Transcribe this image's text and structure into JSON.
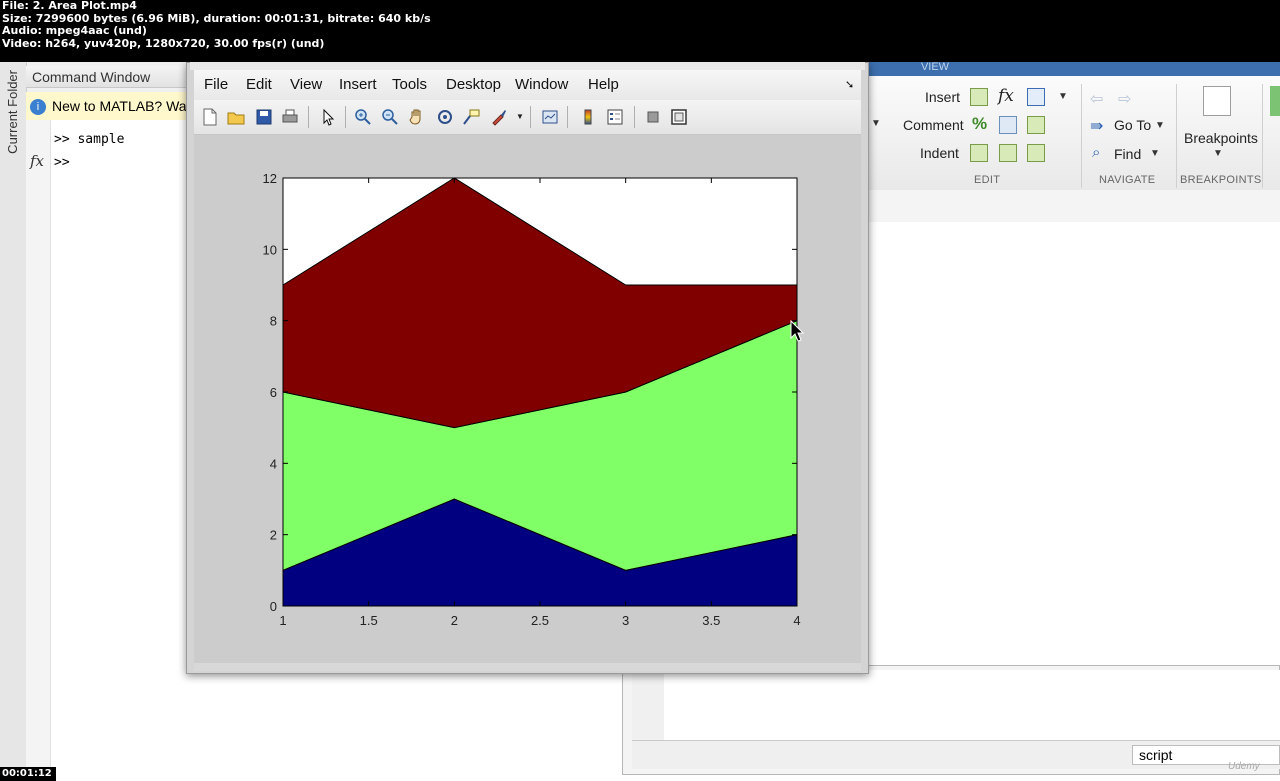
{
  "video_info": {
    "line1": "File: 2. Area Plot.mp4",
    "line2": "Size: 7299600 bytes (6.96 MiB), duration: 00:01:31, bitrate: 640 kb/s",
    "line3": "Audio: mpeg4aac (und)",
    "line4": "Video: h264, yuv420p, 1280x720, 30.00 fps(r) (und)"
  },
  "timecode": "00:01:12",
  "matlab": {
    "left_strip_label": "Current Folder",
    "command_window": {
      "title": "Command Window",
      "banner": "New to MATLAB? Wa",
      "lines": [
        ">> sample",
        ">>"
      ],
      "fx_symbol": "fx"
    },
    "ribbon": {
      "tab_label": "VIEW",
      "edit_rows": [
        {
          "label": "Insert",
          "extra": "fx"
        },
        {
          "label": "Comment",
          "extra": "%"
        },
        {
          "label": "Indent",
          "extra": ""
        }
      ],
      "navigate": {
        "goto_label": "Go To",
        "find_label": "Find"
      },
      "breakpoints_label": "Breakpoints",
      "sections": [
        "EDIT",
        "NAVIGATE",
        "BREAKPOINTS"
      ]
    },
    "editor": {
      "status_value": "script"
    }
  },
  "figure": {
    "menu": [
      "File",
      "Edit",
      "View",
      "Insert",
      "Tools",
      "Desktop",
      "Window",
      "Help"
    ],
    "toolbar_icons": [
      "new-figure-icon",
      "open-file-icon",
      "save-icon",
      "print-icon",
      "select-arrow-icon",
      "zoom-in-icon",
      "zoom-out-icon",
      "pan-hand-icon",
      "rotate-3d-icon",
      "data-cursor-icon",
      "brush-icon",
      "brush-dropdown-icon",
      "link-plot-icon",
      "colorbar-icon",
      "legend-icon",
      "hide-plot-tools-icon",
      "show-plot-tools-icon"
    ]
  },
  "chart_data": {
    "type": "area",
    "stacked": true,
    "x": [
      1,
      2,
      3,
      4
    ],
    "series": [
      {
        "values": [
          1,
          3,
          1,
          2
        ],
        "color": "#000080"
      },
      {
        "values": [
          5,
          2,
          5,
          6
        ],
        "color": "#80ff66"
      },
      {
        "values": [
          3,
          7,
          3,
          1
        ],
        "color": "#800000"
      }
    ],
    "xlim": [
      1,
      4
    ],
    "ylim": [
      0,
      12
    ],
    "xticks": [
      "1",
      "1.5",
      "2",
      "2.5",
      "3",
      "3.5",
      "4"
    ],
    "yticks": [
      "0",
      "2",
      "4",
      "6",
      "8",
      "10",
      "12"
    ],
    "background": "#ffffff",
    "grid": false
  },
  "watermark": "Udemy"
}
